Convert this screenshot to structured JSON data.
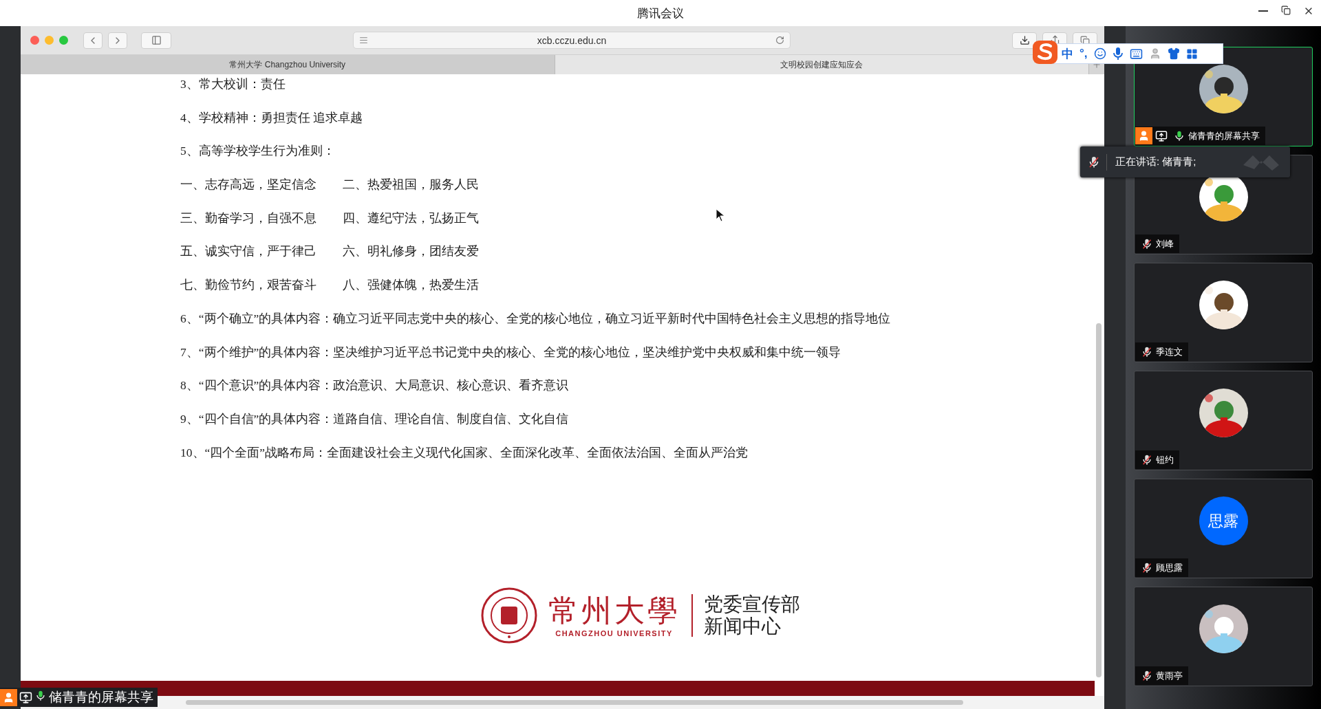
{
  "meeting": {
    "title": "腾讯会议"
  },
  "browser": {
    "url": "xcb.cczu.edu.cn",
    "tabs": [
      {
        "label": "常州大学 Changzhou University",
        "selected": false
      },
      {
        "label": "文明校园创建应知应会",
        "selected": true
      }
    ]
  },
  "document": {
    "lines": [
      {
        "kind": "text",
        "text": "3、常大校训：责任"
      },
      {
        "kind": "text",
        "text": "4、学校精神：勇担责任 追求卓越"
      },
      {
        "kind": "text",
        "text": "5、高等学校学生行为准则："
      },
      {
        "kind": "pair",
        "left": "一、志存高远，坚定信念",
        "right": "二、热爱祖国，服务人民"
      },
      {
        "kind": "pair",
        "left": "三、勤奋学习，自强不息",
        "right": "四、遵纪守法，弘扬正气"
      },
      {
        "kind": "pair",
        "left": "五、诚实守信，严于律己",
        "right": "六、明礼修身，团结友爱"
      },
      {
        "kind": "pair",
        "left": "七、勤俭节约，艰苦奋斗",
        "right": "八、强健体魄，热爱生活"
      },
      {
        "kind": "text",
        "text": "6、“两个确立”的具体内容：确立习近平同志党中央的核心、全党的核心地位，确立习近平新时代中国特色社会主义思想的指导地位"
      },
      {
        "kind": "text",
        "text": "7、“两个维护”的具体内容：坚决维护习近平总书记党中央的核心、全党的核心地位，坚决维护党中央权威和集中统一领导"
      },
      {
        "kind": "text",
        "text": "8、“四个意识”的具体内容：政治意识、大局意识、核心意识、看齐意识"
      },
      {
        "kind": "text",
        "text": "9、“四个自信”的具体内容：道路自信、理论自信、制度自信、文化自信"
      },
      {
        "kind": "text",
        "text": "10、“四个全面”战略布局：全面建设社会主义现代化国家、全面深化改革、全面依法治国、全面从严治党"
      }
    ],
    "footer": {
      "logo_name": "常州大學",
      "logo_english": "CHANGZHOU UNIVERSITY",
      "department": "党委宣传部",
      "center": "新闻中心"
    }
  },
  "ime": {
    "mode": "中",
    "punct": "°,"
  },
  "speaking": {
    "text": "正在讲话: 储青青;"
  },
  "participants": [
    {
      "name": "储青青的屏幕共享",
      "kind": "sharing",
      "muted": false,
      "active": true
    },
    {
      "name": "刘峰",
      "kind": "member",
      "muted": true,
      "active": false
    },
    {
      "name": "季连文",
      "kind": "member",
      "muted": true,
      "active": false
    },
    {
      "name": "钮约",
      "kind": "member",
      "muted": true,
      "active": false
    },
    {
      "name": "顾思露",
      "kind": "member",
      "initials": "思露",
      "muted": true,
      "active": false
    },
    {
      "name": "黄雨亭",
      "kind": "member",
      "muted": true,
      "active": false
    }
  ],
  "share_label": {
    "text": "储青青的屏幕共享",
    "muted": false
  }
}
